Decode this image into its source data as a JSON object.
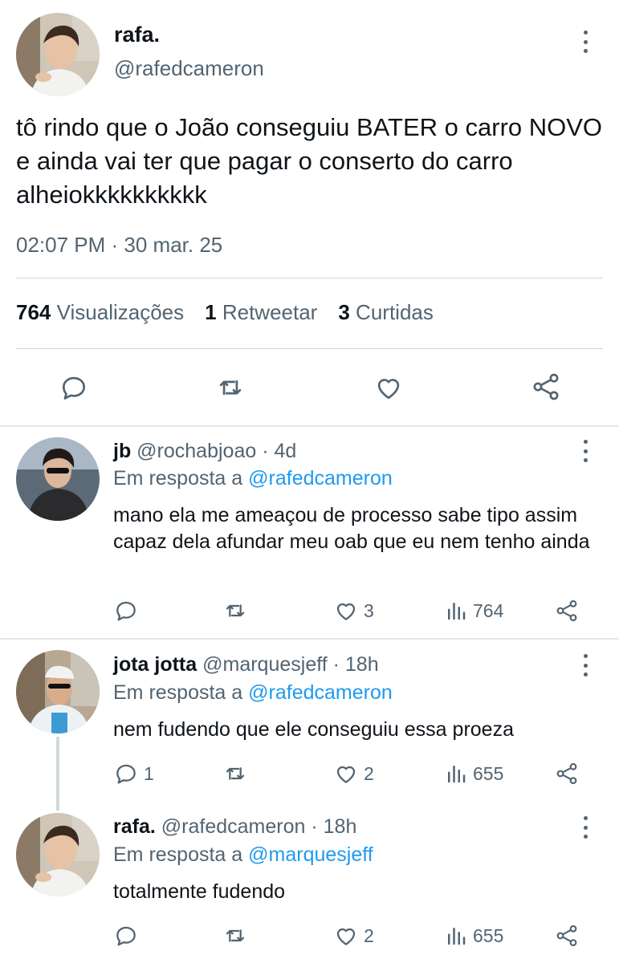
{
  "main_tweet": {
    "name": "rafa.",
    "handle": "@rafedcameron",
    "text": "tô rindo que o João conseguiu BATER o carro NOVO e ainda vai ter que pagar o conserto do carro alheiokkkkkkkkkk",
    "timestamp": "02:07 PM · 30 mar. 25",
    "stats": {
      "views_count": "764",
      "views_label": "Visualizações",
      "retweets_count": "1",
      "retweets_label": "Retweetar",
      "likes_count": "3",
      "likes_label": "Curtidas"
    },
    "actions": [
      "reply-icon",
      "retweet-icon",
      "like-icon",
      "share-icon"
    ]
  },
  "replies": [
    {
      "name": "jb",
      "handle": "@rochabjoao",
      "time": "· 4d",
      "reply_prefix": "Em resposta a",
      "reply_to": "@rafedcameron",
      "text": "mano ela me ameaçou de processo sabe tipo assim capaz dela afundar meu oab que eu nem tenho ainda",
      "replies": "",
      "retweets": "",
      "likes": "3",
      "views": "764"
    },
    {
      "name": "jota jotta",
      "handle": "@marquesjeff",
      "time": "· 18h",
      "reply_prefix": "Em resposta a",
      "reply_to": "@rafedcameron",
      "text": "nem fudendo que ele conseguiu essa proeza",
      "replies": "1",
      "retweets": "",
      "likes": "2",
      "views": "655"
    },
    {
      "name": "rafa.",
      "handle": "@rafedcameron",
      "time": "· 18h",
      "reply_prefix": "Em resposta a",
      "reply_to": "@marquesjeff",
      "text": "totalmente fudendo",
      "replies": "",
      "retweets": "",
      "likes": "2",
      "views": "655"
    }
  ],
  "colors": {
    "text": "#0f1419",
    "secondary": "#536471",
    "link": "#1d9bf0",
    "divider": "#cfd9de"
  }
}
